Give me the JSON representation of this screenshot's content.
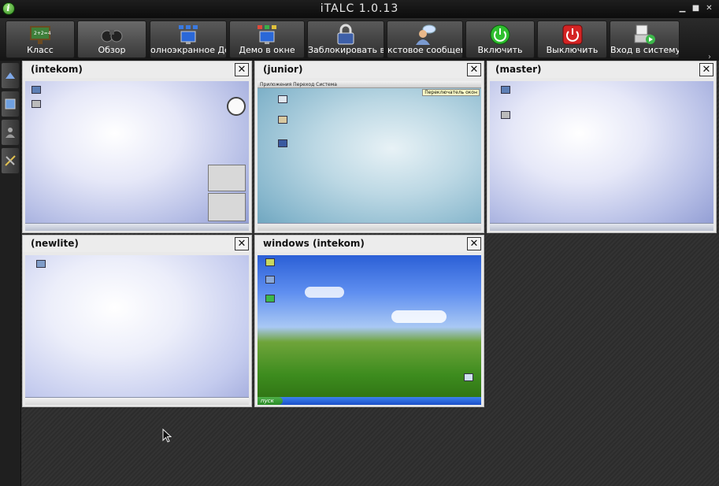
{
  "window": {
    "title": "iTALC 1.0.13",
    "app_icon_glyph": "i",
    "minimize_glyph": "▁",
    "maximize_glyph": "■",
    "close_glyph": "✕"
  },
  "toolbar": {
    "buttons": [
      {
        "label": "Класс",
        "icon": "classroom-board-icon"
      },
      {
        "label": "Обзор",
        "icon": "binoculars-icon"
      },
      {
        "label": "олноэкранное Дем",
        "icon": "fullscreen-demo-icon"
      },
      {
        "label": "Демо в окне",
        "icon": "window-demo-icon"
      },
      {
        "label": "Заблокировать все",
        "icon": "lock-icon"
      },
      {
        "label": "кстовое сообщени",
        "icon": "text-message-icon"
      },
      {
        "label": "Включить",
        "icon": "power-on-icon"
      },
      {
        "label": "Выключить",
        "icon": "power-off-icon"
      },
      {
        "label": "Вход в систему",
        "icon": "logon-icon"
      }
    ],
    "more_glyph": "›"
  },
  "sidebar": {
    "items": [
      "snapshot-icon",
      "overview-icon",
      "user-icon",
      "tools-icon"
    ]
  },
  "clients": [
    {
      "name": "(intekom)",
      "desktop": "kde"
    },
    {
      "name": "(junior)",
      "desktop": "gnome",
      "menu": "Приложения   Переход   Система",
      "tooltip": "Переключатель окон"
    },
    {
      "name": "(master)",
      "desktop": "kde"
    },
    {
      "name": "(newlite)",
      "desktop": "kde-lite"
    },
    {
      "name": "windows (intekom)",
      "desktop": "xp",
      "start_label": "пуск"
    }
  ],
  "close_glyph": "✕"
}
